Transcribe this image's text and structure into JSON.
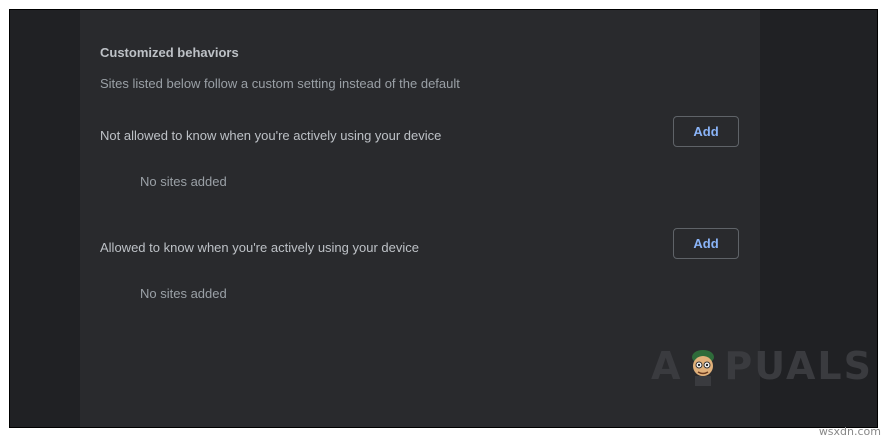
{
  "section": {
    "title": "Customized behaviors",
    "description": "Sites listed below follow a custom setting instead of the default"
  },
  "rows": [
    {
      "label": "Not allowed to know when you're actively using your device",
      "add_label": "Add",
      "empty_text": "No sites added"
    },
    {
      "label": "Allowed to know when you're actively using your device",
      "add_label": "Add",
      "empty_text": "No sites added"
    }
  ],
  "watermark": {
    "logo_text_left": "A",
    "logo_text_right": "PUALS",
    "site": "wsxdn.com"
  },
  "colors": {
    "page_background": "#202124",
    "panel_background": "#292a2d",
    "text_primary": "#bdc1c6",
    "text_secondary": "#9aa0a6",
    "accent": "#8ab4f8",
    "button_border": "#5f6368"
  }
}
